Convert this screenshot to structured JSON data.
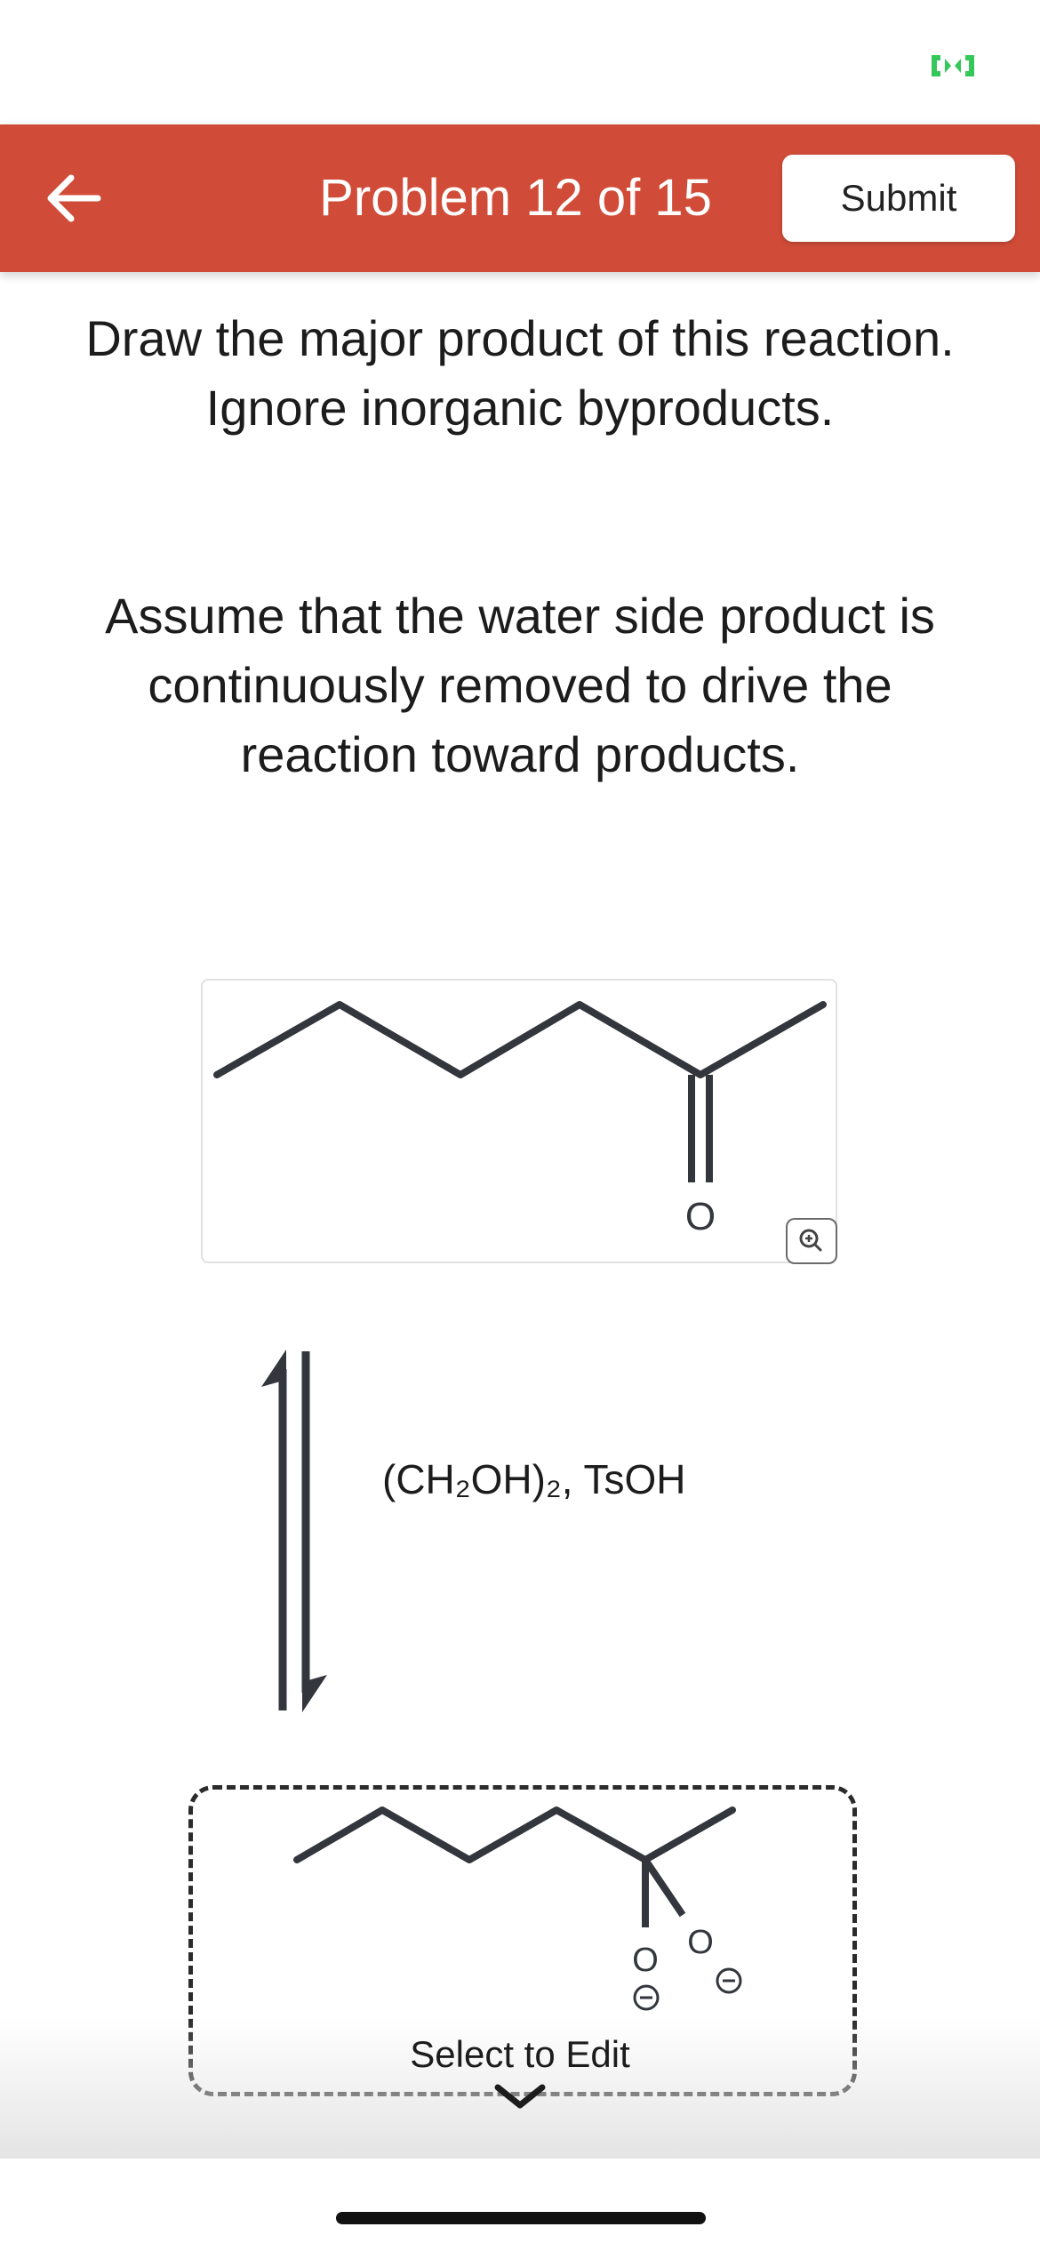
{
  "header": {
    "title": "Problem 12 of 15",
    "submit_label": "Submit",
    "back_icon": "arrow-left-icon",
    "background_color": "#d14c38"
  },
  "status_bar": {
    "indicator_icon": "camera-in-use-indicator-icon",
    "indicator_color": "#34c759"
  },
  "question": {
    "paragraph_1": "Draw the major product of this reaction. Ignore inorganic byproducts.",
    "paragraph_2": "Assume that the water side product is continuously removed to drive the reaction toward products."
  },
  "reactant": {
    "oxygen_label": "O",
    "zoom_icon": "zoom-in-icon"
  },
  "reaction": {
    "reagents": "(CH₂OH)₂, TsOH",
    "arrow_icon": "equilibrium-arrows-icon"
  },
  "answer": {
    "oxygen_label_1": "O",
    "oxygen_label_2": "O",
    "charge_icon_1": "negative-charge-icon",
    "charge_icon_2": "negative-charge-icon",
    "select_label": "Select to Edit",
    "chevron_icon": "chevron-down-icon"
  }
}
